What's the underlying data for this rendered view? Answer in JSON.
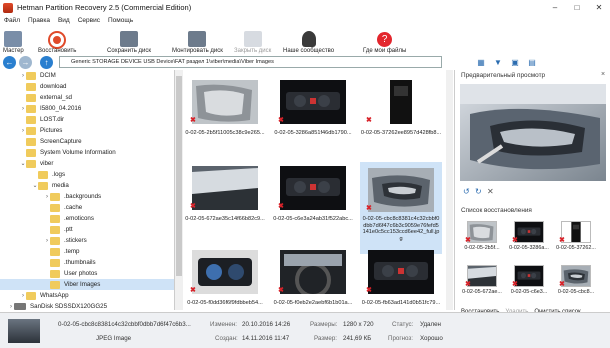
{
  "window": {
    "title": "Hetman Partition Recovery 2.5 (Commercial Edition)",
    "controls": [
      "minimize-icon",
      "maximize-icon",
      "close-icon"
    ]
  },
  "menu": [
    "Файл",
    "Правка",
    "Вид",
    "Сервис",
    "Помощь"
  ],
  "toolbar": [
    {
      "label": "Мастер",
      "icon": "wizard-icon",
      "color": "#7a8ea8",
      "enabled": true
    },
    {
      "label": "Восстановить",
      "icon": "lifebuoy-icon",
      "color": "#e04a2a",
      "enabled": true
    },
    {
      "label": "Сохранить диск",
      "icon": "save-disk-icon",
      "color": "#6d7b8c",
      "enabled": true
    },
    {
      "label": "Монтировать диск",
      "icon": "mount-disk-icon",
      "color": "#6d7b8c",
      "enabled": true
    },
    {
      "label": "Закрыть диск",
      "icon": "close-disk-icon",
      "color": "#9aa6b3",
      "enabled": false
    },
    {
      "label": "Наше сообщество",
      "icon": "community-icon",
      "color": "#3a3a3a",
      "enabled": true
    },
    {
      "label": "Где мои файлы",
      "icon": "help-icon",
      "color": "#e3262d",
      "enabled": true
    }
  ],
  "address": {
    "path": "Generic STORAGE DEVICE USB Device\\FAT раздел 1\\viber\\media\\Viber Images"
  },
  "view_icons": [
    "view-mode-icon",
    "filter-icon",
    "save-icon",
    "panel-icon"
  ],
  "tree": [
    {
      "label": "DCIM",
      "indent": 1,
      "type": "folder",
      "chev": ">"
    },
    {
      "label": "download",
      "indent": 1,
      "type": "folder",
      "chev": ""
    },
    {
      "label": "external_sd",
      "indent": 1,
      "type": "folder",
      "chev": ""
    },
    {
      "label": "I5800_04.2016",
      "indent": 1,
      "type": "folder",
      "chev": ">"
    },
    {
      "label": "LOST.dir",
      "indent": 1,
      "type": "folder",
      "chev": ""
    },
    {
      "label": "Pictures",
      "indent": 1,
      "type": "folder",
      "chev": ">"
    },
    {
      "label": "ScreenCapture",
      "indent": 1,
      "type": "folder",
      "chev": ""
    },
    {
      "label": "System Volume Information",
      "indent": 1,
      "type": "folder",
      "chev": ""
    },
    {
      "label": "viber",
      "indent": 1,
      "type": "folder",
      "chev": "v"
    },
    {
      "label": ".logs",
      "indent": 2,
      "type": "folder",
      "chev": ""
    },
    {
      "label": "media",
      "indent": 2,
      "type": "folder",
      "chev": "v"
    },
    {
      "label": ".backgrounds",
      "indent": 3,
      "type": "folder",
      "chev": ">"
    },
    {
      "label": ".cache",
      "indent": 3,
      "type": "folder",
      "chev": ""
    },
    {
      "label": ".emoticons",
      "indent": 3,
      "type": "folder",
      "chev": ""
    },
    {
      "label": ".ptt",
      "indent": 3,
      "type": "folder",
      "chev": ""
    },
    {
      "label": ".stickers",
      "indent": 3,
      "type": "folder",
      "chev": ">"
    },
    {
      "label": ".temp",
      "indent": 3,
      "type": "folder",
      "chev": ""
    },
    {
      "label": ".thumbnails",
      "indent": 3,
      "type": "folder",
      "chev": ""
    },
    {
      "label": "User photos",
      "indent": 3,
      "type": "folder",
      "chev": ""
    },
    {
      "label": "Viber Images",
      "indent": 3,
      "type": "folder",
      "chev": "",
      "selected": true
    },
    {
      "label": "WhatsApp",
      "indent": 1,
      "type": "folder",
      "chev": ">"
    },
    {
      "label": "SanDisk SDSSDX120GG25",
      "indent": 0,
      "type": "drive",
      "chev": ">"
    }
  ],
  "files": [
    {
      "name": "0-02-05-2b5f11005c38c9e265...",
      "theme": "seat"
    },
    {
      "name": "0-02-05-3286a851f46db1790...",
      "theme": "dash"
    },
    {
      "name": "0-02-05-37262ee8957d428fb8...",
      "theme": "tall-dark"
    },
    {
      "name": "0-02-05-672ae35c14f66b82c9...",
      "theme": "sunroof"
    },
    {
      "name": "0-02-05-c6e3a24ab31f522abc...",
      "theme": "dash"
    },
    {
      "name": "0-02-05-cbc8c8381c4c32cbbf0dbb7d6f47c6b3c9059e76fefd5141e0c5cc153ccd6ee42_full.jpg",
      "theme": "door",
      "selected": true
    },
    {
      "name": "0-02-05-f0dd36f6f9fdbbeb54...",
      "theme": "cluster"
    },
    {
      "name": "0-02-05-f0eb2e2aebf6b1b01a...",
      "theme": "wheel"
    },
    {
      "name": "0-02-05-fb63ad141d0b51fc79...",
      "theme": "dash"
    }
  ],
  "preview_pane": {
    "title": "Предварительный просмотр",
    "close": "×",
    "controls": [
      "rotate-left-icon",
      "rotate-right-icon",
      "delete-icon"
    ]
  },
  "recovery_list": {
    "title": "Список восстановления",
    "items": [
      {
        "name": "0-02-05-2b5f..."
      },
      {
        "name": "0-02-05-3286a..."
      },
      {
        "name": "0-02-05-37262..."
      },
      {
        "name": "0-02-05-672ae..."
      },
      {
        "name": "0-02-05-c6e3..."
      },
      {
        "name": "0-02-05-cbc8..."
      }
    ],
    "actions": {
      "recover": "Восстановить",
      "delete": "Удалить",
      "clear": "Очистить список"
    }
  },
  "status": {
    "filename": "0-02-05-cbc8c8381c4c32cbbf0dbb7d6f47c6b3...",
    "filetype": "JPEG Image",
    "changed_label": "Изменен:",
    "changed_value": "20.10.2016 14:26",
    "created_label": "Создан:",
    "created_value": "14.11.2016 11:47",
    "dims_label": "Размеры:",
    "dims_value": "1280 x 720",
    "size_label": "Размер:",
    "size_value": "241,69 КБ",
    "status_label": "Статус:",
    "status_value": "Удален",
    "forecast_label": "Прогноз:",
    "forecast_value": "Хорошо"
  }
}
